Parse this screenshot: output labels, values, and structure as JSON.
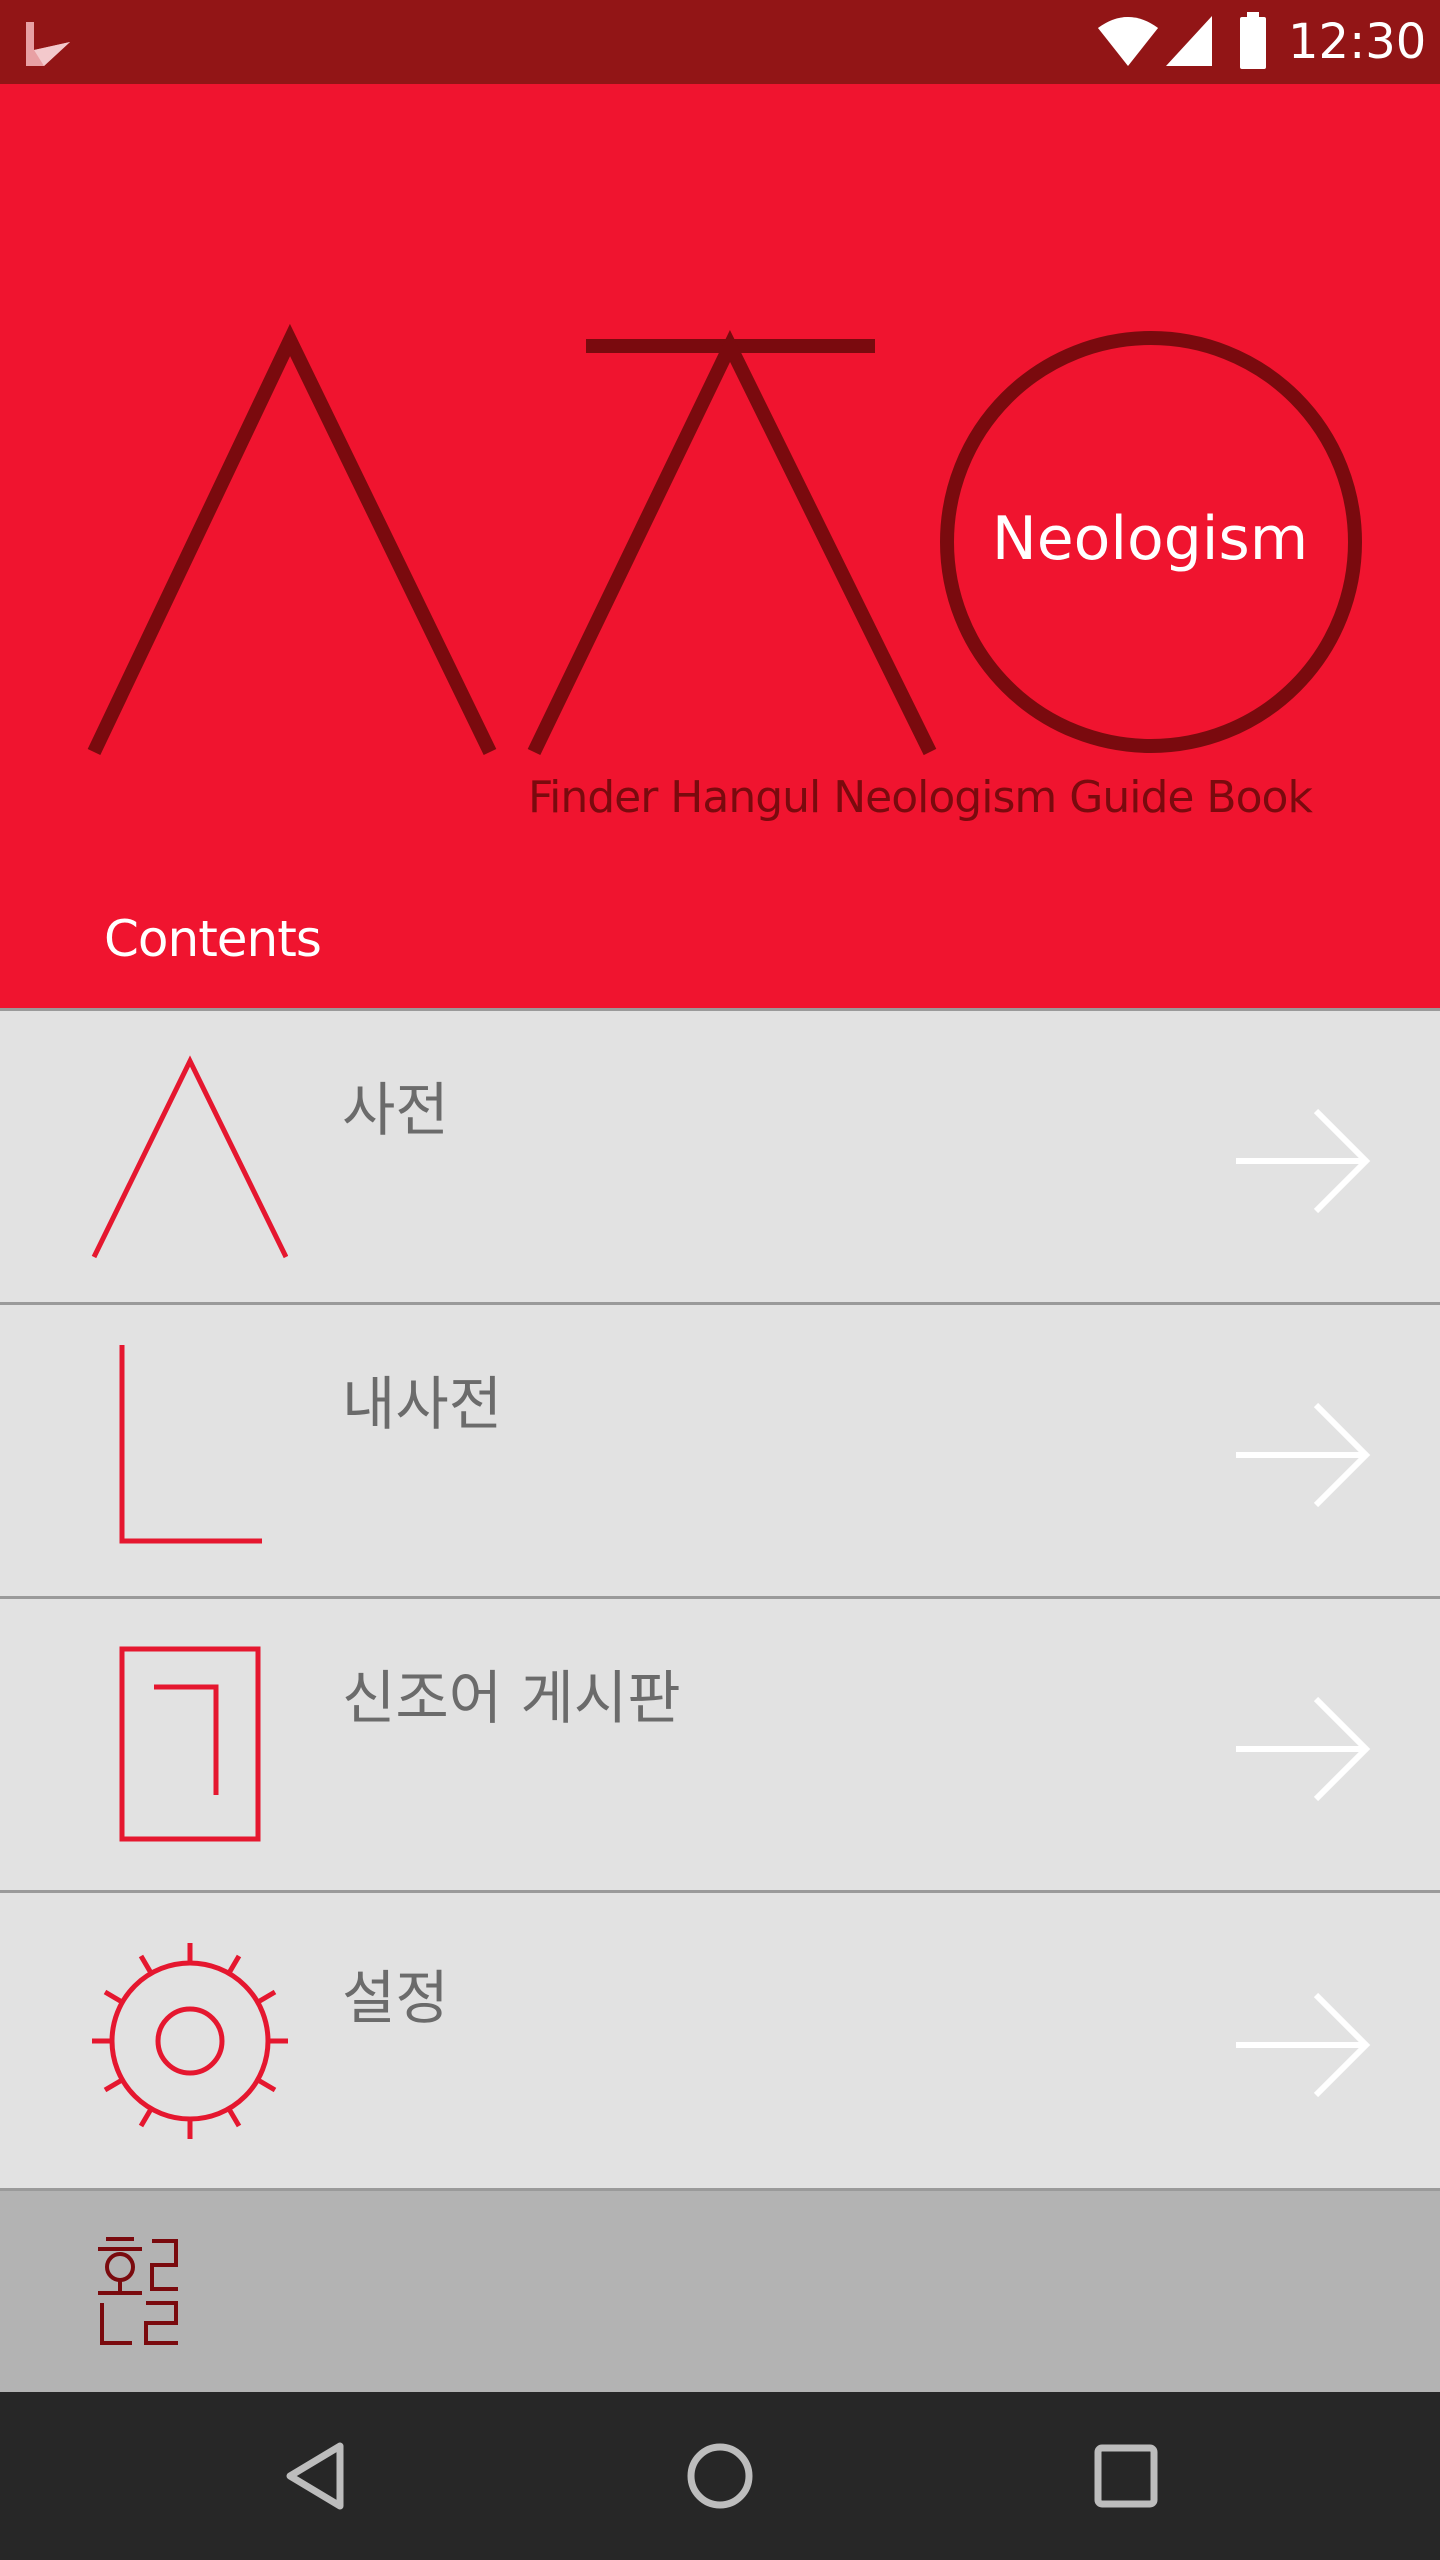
{
  "status_bar": {
    "time": "12:30",
    "icons": [
      "app-notification-icon",
      "wifi-icon",
      "cell-signal-icon",
      "battery-icon"
    ]
  },
  "hero": {
    "badge_text": "Neologism",
    "subtitle": "Finder Hangul Neologism Guide Book",
    "section_label": "Contents"
  },
  "menu": {
    "items": [
      {
        "label": "사전",
        "icon": "siot-icon"
      },
      {
        "label": "내사전",
        "icon": "nieun-icon"
      },
      {
        "label": "신조어 게시판",
        "icon": "giyeok-box-icon"
      },
      {
        "label": "설정",
        "icon": "gear-icon"
      }
    ]
  },
  "footer": {
    "logo": "hangul-logo"
  },
  "nav_bar": {
    "buttons": [
      "back-icon",
      "home-icon",
      "recents-icon"
    ]
  },
  "colors": {
    "status_bar": "#921516",
    "hero_background": "#f0142f",
    "logo_strokes": "#7a0a0e",
    "menu_background": "#e2e2e2",
    "menu_icon": "#e5172f",
    "menu_label": "#6b6b6b",
    "footer_band": "#b3b3b3",
    "nav_bar": "#272727"
  }
}
